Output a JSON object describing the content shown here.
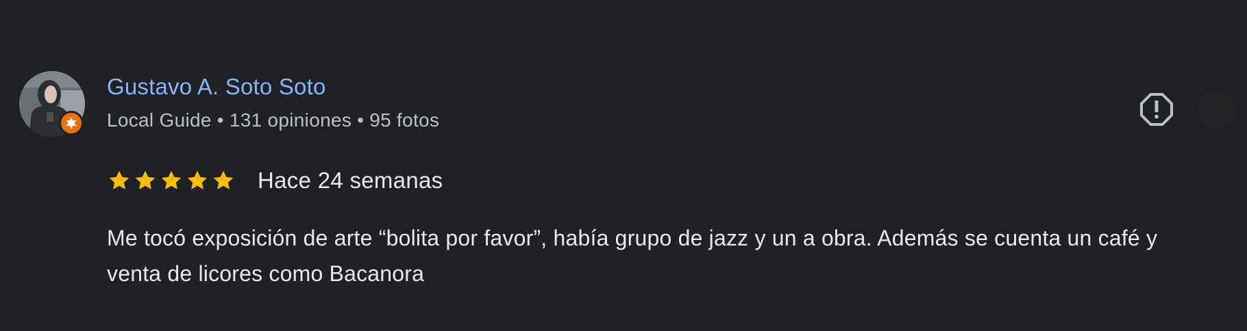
{
  "review": {
    "author": {
      "name": "Gustavo A. Soto Soto",
      "role": "Local Guide",
      "reviews_count": "131 opiniones",
      "photos_count": "95 fotos",
      "separator": "•",
      "avatar_icon": "user-avatar-photo",
      "badge_icon": "local-guide-badge-icon",
      "badge_color": "#e8710a"
    },
    "rating": {
      "value": 5,
      "max": 5,
      "star_color": "#fbbc04"
    },
    "date": "Hace 24 semanas",
    "text": "Me tocó exposición de arte “bolita por favor”, había grupo de jazz y un a obra. Además se cuenta un café y venta de licores como Bacanora",
    "actions": {
      "report_icon": "report-icon"
    },
    "colors": {
      "background": "#202124",
      "name": "#8ab4f8",
      "meta": "#bdc1c6",
      "text": "#e8eaed"
    }
  }
}
